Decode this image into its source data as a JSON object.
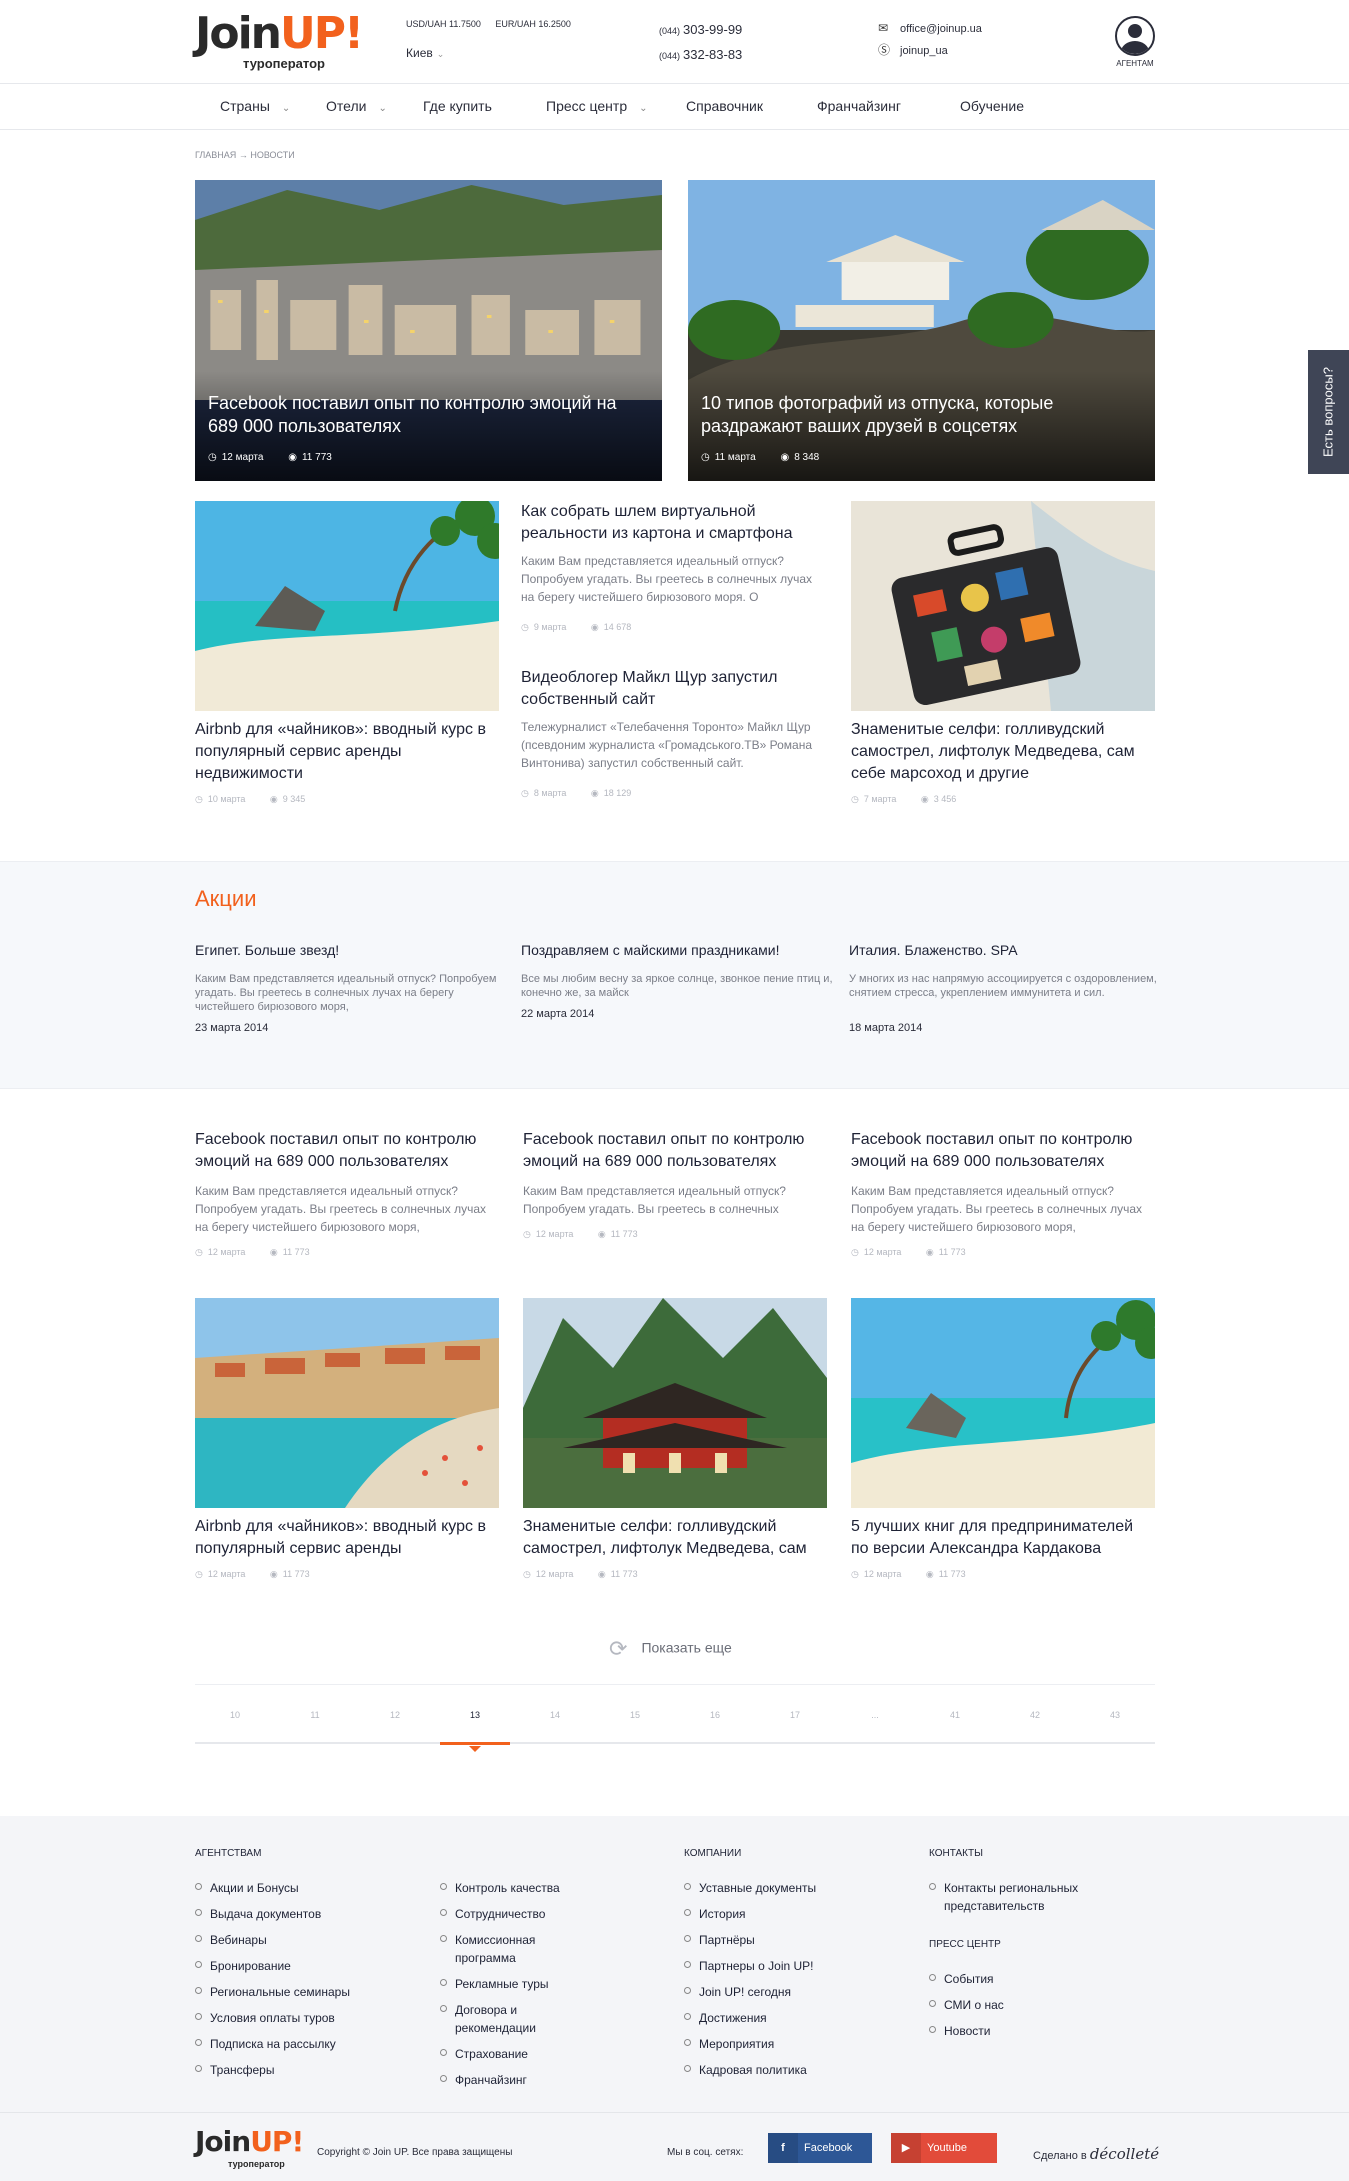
{
  "header": {
    "logo_main": "Join",
    "logo_up": "UP!",
    "logo_sub": "туроператор",
    "rate_usd": "USD/UAH 11.7500",
    "rate_eur": "EUR/UAH 16.2500",
    "city": "Киев",
    "phone1_code": "(044)",
    "phone1": "303-99-99",
    "phone2_code": "(044)",
    "phone2": "332-83-83",
    "email": "office@joinup.ua",
    "skype": "joinup_ua",
    "agents_label": "АГЕНТАМ"
  },
  "nav": {
    "items": [
      "Страны",
      "Отели",
      "Где купить",
      "Пресс центр",
      "Справочник",
      "Франчайзинг",
      "Обучение"
    ]
  },
  "breadcrumb": {
    "home": "ГЛАВНАЯ",
    "arrow": "→",
    "current": "НОВОСТИ"
  },
  "side_tab": "Есть вопросы?",
  "hero": [
    {
      "title": "Facebook поставил опыт по контролю эмоций на 689 000 пользователях",
      "date": "12 марта",
      "views": "11 773"
    },
    {
      "title": "10 типов фотографий из отпуска, которые раздражают ваших друзей в соцсетях",
      "date": "11 марта",
      "views": "8 348"
    }
  ],
  "row1": {
    "left": {
      "title": "Airbnb для «чайников»: вводный курс в популярный сервис аренды недвижимости",
      "date": "10 марта",
      "views": "9 345"
    },
    "mid1": {
      "title": "Как собрать шлем виртуальной реальности из картона и смартфона",
      "text": "Каким Вам представляется идеальный отпуск? Попробуем угадать. Вы греетесь в солнечных лучах на берегу чистейшего бирюзового моря. О",
      "date": "9 марта",
      "views": "14 678"
    },
    "mid2": {
      "title": "Видеоблогер Майкл Щур запустил собственный сайт",
      "text": "Тележурналист «Телебачення Торонто» Майкл Щур (псевдоним журналиста «Громадського.TB» Романа Винтонива) запустил собственный сайт.",
      "date": "8 марта",
      "views": "18 129"
    },
    "right": {
      "title": "Знаменитые селфи: голливудский самострел, лифтолук Медведева, сам себе марсоход и другие",
      "date": "7 марта",
      "views": "3 456"
    }
  },
  "promos": {
    "heading": "Акции",
    "items": [
      {
        "title": "Египет. Больше звезд!",
        "text": "Каким Вам представляется идеальный отпуск? Попробуем угадать. Вы греетесь в солнечных лучах на берегу чистейшего бирюзового моря,",
        "date": "23 марта 2014"
      },
      {
        "title": "Поздравляем с майскими праздниками!",
        "text": "Все мы любим весну за яркое солнце, звонкое пение птиц и, конечно же, за майск",
        "date": "22 марта 2014"
      },
      {
        "title": "Италия. Блаженство. SPA",
        "text": "У многих из нас напрямую ассоциируется с оздоровлением, снятием стресса, укреплением иммунитета и сил.",
        "date": "18 марта 2014"
      }
    ]
  },
  "text_cards": [
    {
      "title": "Facebook поставил опыт по контролю эмоций на 689 000 пользователях",
      "text": "Каким Вам представляется идеальный отпуск? Попробуем угадать. Вы греетесь в солнечных лучах на берегу чистейшего бирюзового моря,",
      "date": "12 марта",
      "views": "11 773"
    },
    {
      "title": "Facebook поставил опыт по контролю эмоций на 689 000 пользователях",
      "text": "Каким Вам представляется идеальный отпуск? Попробуем угадать. Вы греетесь в солнечных",
      "date": "12 марта",
      "views": "11 773"
    },
    {
      "title": "Facebook поставил опыт по контролю эмоций на 689 000 пользователях",
      "text": "Каким Вам представляется идеальный отпуск? Попробуем угадать. Вы греетесь в солнечных лучах на берегу чистейшего бирюзового моря,",
      "date": "12 марта",
      "views": "11 773"
    }
  ],
  "image_cards": [
    {
      "title": "Airbnb для «чайников»: вводный курс в популярный сервис аренды",
      "date": "12 марта",
      "views": "11 773"
    },
    {
      "title": "Знаменитые селфи: голливудский самострел, лифтолук Медведева, сам",
      "date": "12 марта",
      "views": "11 773"
    },
    {
      "title": "5 лучших книг для предпринимателей по версии Александра Кардакова",
      "date": "12 марта",
      "views": "11 773"
    }
  ],
  "show_more": "Показать еще",
  "pagination": {
    "pages": [
      "10",
      "11",
      "12",
      "13",
      "14",
      "15",
      "16",
      "17",
      "...",
      "41",
      "42",
      "43"
    ],
    "active": "13"
  },
  "footer": {
    "col1_heading": "АГЕНТСТВАМ",
    "col1": [
      "Акции и Бонусы",
      "Выдача документов",
      "Вебинары",
      "Бронирование",
      "Региональные семинары",
      "Условия оплаты туров",
      "Подписка на рассылку",
      "Трансферы"
    ],
    "col2": [
      "Контроль качества",
      "Сотрудничество",
      "Комиссионная программа",
      "Рекламные туры",
      "Договора и рекомендации",
      "Страхование",
      "Франчайзинг"
    ],
    "col3_heading": "КОМПАНИИ",
    "col3": [
      "Уставные документы",
      "История",
      "Партнёры",
      "Партнеры о Join UP!",
      "Join UP! сегодня",
      "Достижения",
      "Мероприятия",
      "Кадровая политика"
    ],
    "col4_heading": "КОНТАКТЫ",
    "col4": [
      "Контакты региональных представительств"
    ],
    "col5_heading": "ПРЕСС ЦЕНТР",
    "col5": [
      "События",
      "СМИ о нас",
      "Новости"
    ],
    "logo_main": "Join",
    "logo_up": "UP!",
    "logo_sub": "туроператор",
    "copyright": "Copyright © Join UP. Все права защищены",
    "social_label": "Мы в соц. сетях:",
    "facebook": "Facebook",
    "youtube": "Youtube",
    "made_label": "Сделано в",
    "made_brand": "décolleté"
  }
}
